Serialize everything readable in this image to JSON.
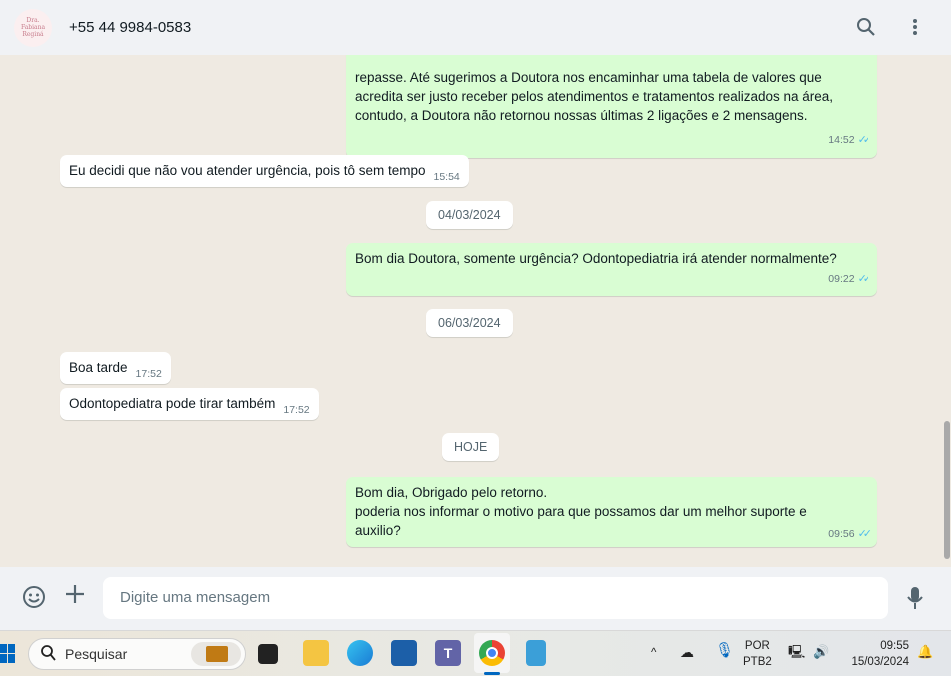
{
  "header": {
    "avatar_text": "Dra. Fabiana Reginá",
    "contact": "+55 44 9984-0583",
    "icons": [
      "search-icon",
      "menu-icon"
    ]
  },
  "messages": [
    {
      "dir": "out",
      "lines": [
        "repasse. Até sugerimos a Doutora nos encaminhar uma tabela de valores que",
        "acredita ser justo receber pelos atendimentos e tratamentos realizados na área,",
        "contudo, a Doutora não retornou nossas últimas 2 ligações e 2 mensagens."
      ],
      "time": "14:52"
    },
    {
      "dir": "in",
      "text": "Eu decidi que não vou atender urgência, pois tô sem tempo",
      "time": "15:54"
    },
    {
      "date": "04/03/2024"
    },
    {
      "dir": "out",
      "text": "Bom dia Doutora, somente urgência? Odontopediatria irá atender normalmente?",
      "time": "09:22"
    },
    {
      "date": "06/03/2024"
    },
    {
      "dir": "in",
      "text": "Boa tarde",
      "time": "17:52"
    },
    {
      "dir": "in",
      "text": "Odontopediatra pode tirar também",
      "time": "17:52"
    },
    {
      "date": "HOJE"
    },
    {
      "dir": "out",
      "lines": [
        "Bom dia, Obrigado pelo retorno.",
        "poderia nos informar o motivo para que possamos dar um melhor suporte e",
        "auxilio?"
      ],
      "time": "09:56"
    }
  ],
  "footer": {
    "placeholder": "Digite uma mensagem"
  },
  "taskbar": {
    "search": "Pesquisar",
    "lang1": "POR",
    "lang2": "PTB2",
    "time": "09:55",
    "date": "15/03/2024"
  }
}
